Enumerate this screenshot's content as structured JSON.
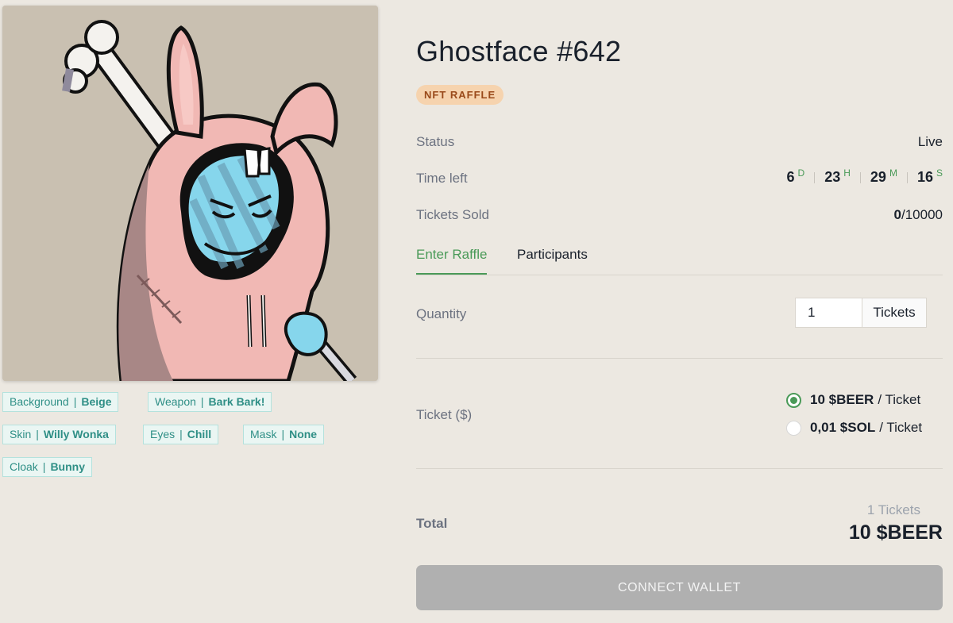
{
  "nft": {
    "image_alt": "Ghostface #642",
    "traits": [
      {
        "name": "Background",
        "value": "Beige"
      },
      {
        "name": "Weapon",
        "value": "Bark Bark!"
      },
      {
        "name": "Skin",
        "value": "Willy Wonka"
      },
      {
        "name": "Eyes",
        "value": "Chill"
      },
      {
        "name": "Mask",
        "value": "None"
      },
      {
        "name": "Cloak",
        "value": "Bunny"
      }
    ],
    "trait_separator": "|"
  },
  "header": {
    "title": "Ghostface #642",
    "badge": "NFT RAFFLE"
  },
  "info": {
    "status_label": "Status",
    "status_value": "Live",
    "time_left_label": "Time left",
    "countdown": [
      {
        "value": "6",
        "unit": "D"
      },
      {
        "value": "23",
        "unit": "H"
      },
      {
        "value": "29",
        "unit": "M"
      },
      {
        "value": "16",
        "unit": "S"
      }
    ],
    "tickets_sold_label": "Tickets Sold",
    "tickets_sold": "0",
    "tickets_total": "/10000"
  },
  "tabs": [
    {
      "label": "Enter Raffle",
      "active": true
    },
    {
      "label": "Participants",
      "active": false
    }
  ],
  "quantity": {
    "label": "Quantity",
    "value": "1",
    "addon": "Tickets"
  },
  "ticket_price": {
    "label": "Ticket ($)",
    "options": [
      {
        "amount": "10 $BEER",
        "suffix": "/ Ticket",
        "selected": true
      },
      {
        "amount": "0,01 $SOL",
        "suffix": "/ Ticket",
        "selected": false
      }
    ]
  },
  "total": {
    "label": "Total",
    "tickets": "1 Tickets",
    "amount": "10 $BEER"
  },
  "connect_button": "CONNECT WALLET",
  "colors": {
    "accent_green": "#4a9a58",
    "badge_bg": "#f6d3ae",
    "trait_text": "#2f8f86",
    "button_disabled": "#b0b0b0",
    "page_bg": "#ece8e1"
  }
}
